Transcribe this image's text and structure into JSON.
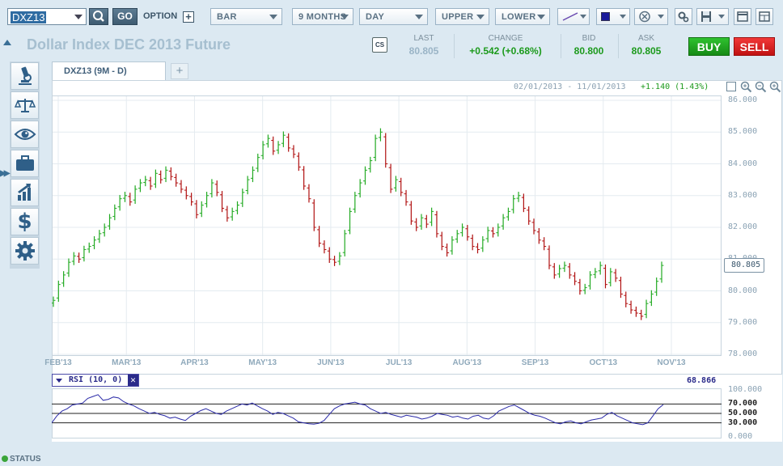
{
  "toolbar": {
    "symbol_value": "DXZ13",
    "go_label": "GO",
    "option_label": "OPTION",
    "chart_type": "BAR",
    "range": "9 MONTHS",
    "interval": "DAY",
    "upper": "UPPER",
    "lower": "LOWER"
  },
  "header": {
    "title": "Dollar Index DEC 2013 Future",
    "cs_label": "CS"
  },
  "quote": {
    "last_label": "LAST",
    "last": "80.805",
    "change_label": "CHANGE",
    "change": "+0.542 (+0.68%)",
    "bid_label": "BID",
    "bid": "80.800",
    "ask_label": "ASK",
    "ask": "80.805",
    "buy_label": "BUY",
    "sell_label": "SELL"
  },
  "tabs": [
    {
      "label": "DXZ13 (9M - D)"
    }
  ],
  "add_tab": "+",
  "chart_info": {
    "date_range": "02/01/2013 - 11/01/2013",
    "period_change": "+1.140 (1.43%)",
    "last_price_tag": "80.805"
  },
  "rsi": {
    "label": "RSI (10, 0)",
    "value": "68.866",
    "close_icon": "✕"
  },
  "status_label": "STATUS",
  "colors": {
    "up": "#22aa22",
    "down": "#b01010",
    "buy": "#1ea01e",
    "sell": "#d92020",
    "accent": "#3a6f96"
  },
  "icons": [
    "microscope-icon",
    "scales-icon",
    "eye-icon",
    "briefcase-icon",
    "growth-chart-icon",
    "dollar-icon",
    "gear-icon"
  ],
  "chart_data": [
    {
      "type": "bar",
      "title": "",
      "x_tick_labels": [
        "FEB'13",
        "MAR'13",
        "APR'13",
        "MAY'13",
        "JUN'13",
        "JUL'13",
        "AUG'13",
        "SEP'13",
        "OCT'13",
        "NOV'13"
      ],
      "y_tick_labels": [
        "86.000",
        "85.000",
        "84.000",
        "83.000",
        "82.000",
        "81.000",
        "80.000",
        "79.000",
        "78.000"
      ],
      "ylim": [
        78,
        86
      ],
      "grid": true,
      "series": [
        {
          "values": [
            79.7,
            80.2,
            80.5,
            80.9,
            81.1,
            81.0,
            81.3,
            81.4,
            81.6,
            81.8,
            82.0,
            82.3,
            82.6,
            82.9,
            83.0,
            82.8,
            83.2,
            83.4,
            83.5,
            83.3,
            83.7,
            83.5,
            83.8,
            83.6,
            83.4,
            83.2,
            83.0,
            82.8,
            82.4,
            82.7,
            83.0,
            83.4,
            83.1,
            82.6,
            82.3,
            82.5,
            82.7,
            83.1,
            83.5,
            83.8,
            84.2,
            84.6,
            84.8,
            84.4,
            84.6,
            84.9,
            84.5,
            84.3,
            83.9,
            83.3,
            82.9,
            82.0,
            81.5,
            81.3,
            81.0,
            80.9,
            81.1,
            81.8,
            82.5,
            83.0,
            83.4,
            83.8,
            84.1,
            84.8,
            85.0,
            84.0,
            83.2,
            83.5,
            83.1,
            82.8,
            82.2,
            82.0,
            82.3,
            82.1,
            82.5,
            81.8,
            81.4,
            81.2,
            81.6,
            81.8,
            82.0,
            81.7,
            81.4,
            81.3,
            81.6,
            81.9,
            81.8,
            82.0,
            82.3,
            82.5,
            82.9,
            83.0,
            82.6,
            82.2,
            81.9,
            81.6,
            81.4,
            80.8,
            80.5,
            80.7,
            80.8,
            80.5,
            80.3,
            80.0,
            80.1,
            80.5,
            80.6,
            80.8,
            80.2,
            80.6,
            80.4,
            79.9,
            79.6,
            79.4,
            79.3,
            79.2,
            79.6,
            79.9,
            80.3,
            80.8
          ]
        }
      ],
      "legend": "none"
    },
    {
      "type": "line",
      "title": "RSI (10, 0)",
      "y_tick_labels": [
        "100.000",
        "70.000",
        "50.000",
        "30.000",
        "0.000"
      ],
      "ylim": [
        0,
        100
      ],
      "reference_lines": [
        70,
        50,
        30
      ],
      "series": [
        {
          "values": [
            30,
            45,
            55,
            60,
            68,
            70,
            72,
            82,
            86,
            90,
            78,
            80,
            85,
            83,
            75,
            70,
            66,
            60,
            55,
            50,
            52,
            48,
            45,
            40,
            42,
            38,
            35,
            44,
            50,
            56,
            60,
            55,
            50,
            48,
            55,
            60,
            65,
            70,
            68,
            72,
            66,
            60,
            55,
            48,
            52,
            50,
            45,
            40,
            32,
            30,
            28,
            27,
            29,
            35,
            48,
            60,
            66,
            70,
            72,
            74,
            70,
            68,
            60,
            55,
            50,
            52,
            48,
            45,
            42,
            46,
            44,
            42,
            38,
            40,
            44,
            50,
            48,
            46,
            42,
            44,
            40,
            38,
            44,
            46,
            40,
            38,
            45,
            55,
            60,
            65,
            68,
            62,
            56,
            50,
            46,
            44,
            40,
            35,
            30,
            28,
            32,
            34,
            30,
            28,
            32,
            36,
            38,
            40,
            48,
            52,
            45,
            40,
            35,
            30,
            28,
            26,
            30,
            45,
            60,
            68.866
          ]
        }
      ],
      "legend": "none"
    }
  ]
}
